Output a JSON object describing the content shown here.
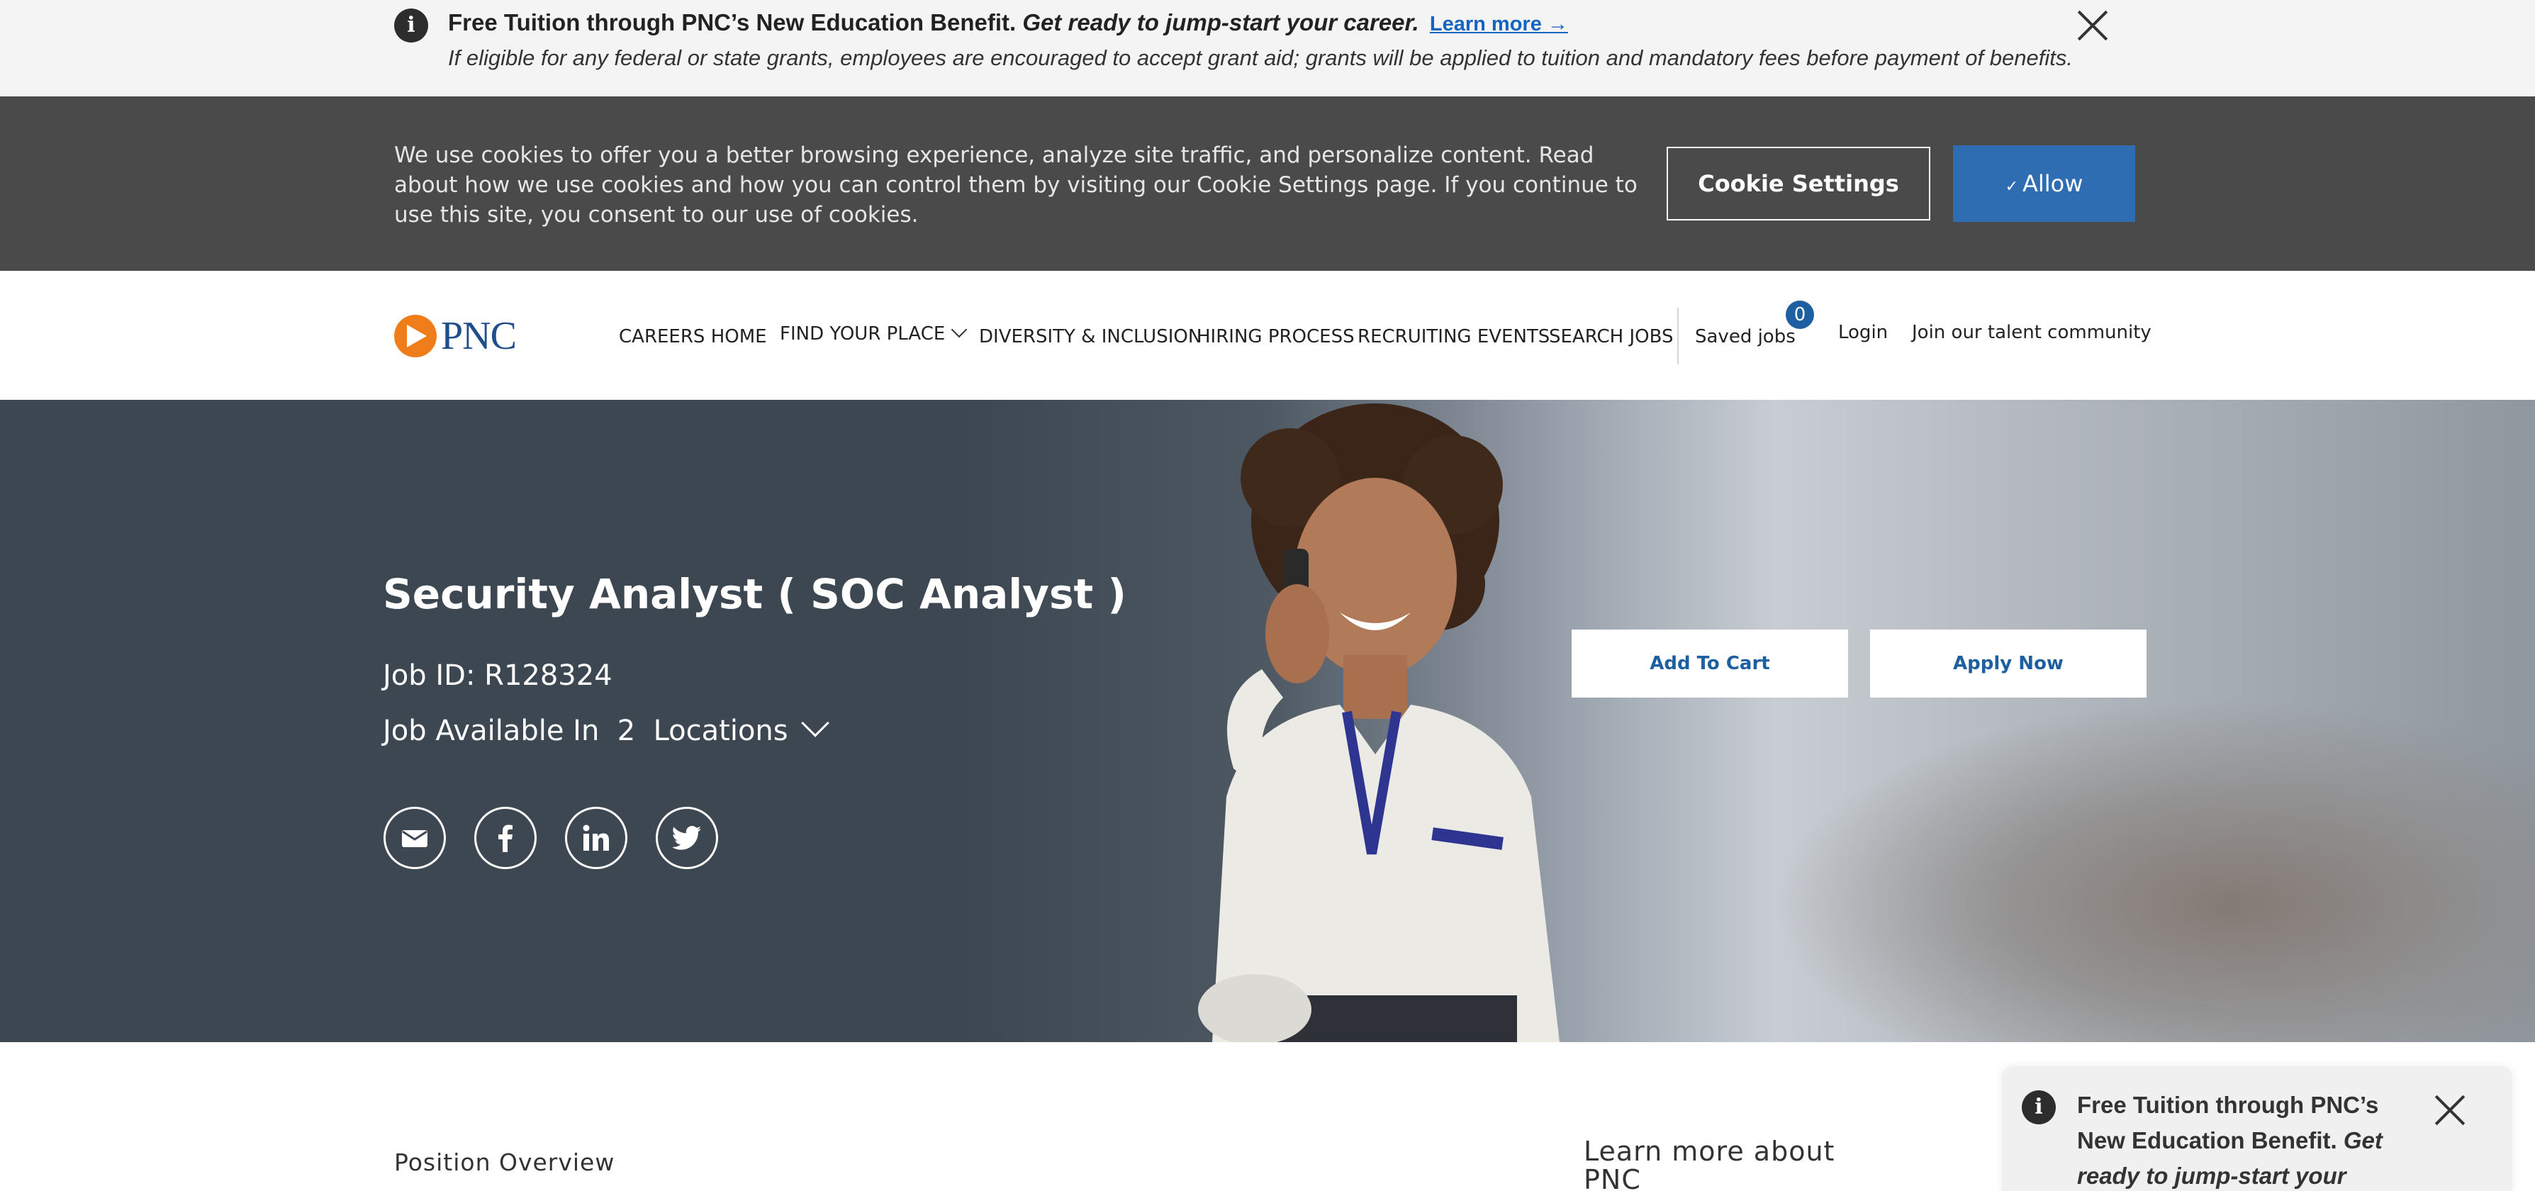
{
  "info_banner": {
    "title": "Free Tuition through PNC’s New Education Benefit.",
    "tagline": "Get ready to jump-start your career.",
    "link": "Learn more →",
    "note": "If eligible for any federal or state grants, employees are encouraged to accept grant aid; grants will be applied to tuition and mandatory fees before payment of benefits.",
    "info_glyph": "i"
  },
  "cookie_bar": {
    "text": "We use cookies to offer you a better browsing experience, analyze site traffic, and personalize content. Read about how we use cookies and how you can control them by visiting our Cookie Settings page. If you continue to use this site, you consent to our use of cookies.",
    "settings_label": "Cookie Settings",
    "allow_label": "Allow",
    "allow_check": "✓"
  },
  "nav": {
    "logo_text": "PNC",
    "items": [
      {
        "label": "CAREERS HOME"
      },
      {
        "label": "FIND YOUR PLACE"
      },
      {
        "label": "DIVERSITY & INCLUSION"
      },
      {
        "label": "HIRING PROCESS"
      },
      {
        "label": "RECRUITING EVENTS"
      },
      {
        "label": "SEARCH JOBS"
      }
    ],
    "saved_jobs": "Saved jobs",
    "saved_count": "0",
    "login": "Login",
    "join": "Join our talent community"
  },
  "hero": {
    "title": "Security Analyst ( SOC Analyst )",
    "job_id": "Job ID: R128324",
    "locations_text": "Job Available In  2  Locations",
    "add_to_cart": "Add To Cart",
    "apply_now": "Apply Now",
    "share_icons": [
      "email-icon",
      "facebook-icon",
      "linkedin-icon",
      "twitter-icon"
    ]
  },
  "content": {
    "position_overview": "Position Overview",
    "learn_more": "Learn more about PNC"
  },
  "popup": {
    "title": "Free Tuition through PNC’s New Education Benefit.",
    "tagline": "Get ready to jump-start your"
  },
  "colors": {
    "brand_blue": "#1d5fa1",
    "brand_orange": "#ef7d1a",
    "allow_button": "#2f6db2",
    "cookie_bar": "#4a4a4a",
    "hero_dark": "#3d4751"
  }
}
